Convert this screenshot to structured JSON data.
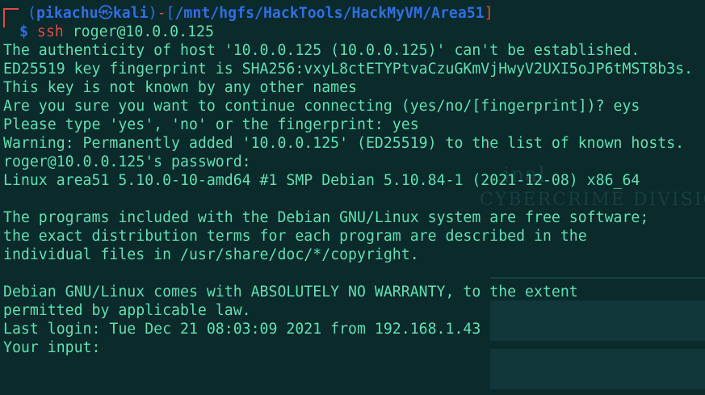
{
  "prompt": {
    "open_paren": "(",
    "user": "pikachu",
    "at_symbol": "㉿",
    "host": "kali",
    "close_paren": ")",
    "dash": "-",
    "open_bracket": "[",
    "path": "/mnt/hgfs/HackTools/HackMyVM/Area51",
    "close_bracket": "]",
    "dollar": "$",
    "command": "ssh",
    "args": "roger@10.0.0.125"
  },
  "output_lines": [
    "The authenticity of host '10.0.0.125 (10.0.0.125)' can't be established.",
    "ED25519 key fingerprint is SHA256:vxyL8ctETYPtvaCzuGKmVjHwyV2UXI5oJP6tMST8b3s.",
    "This key is not known by any other names",
    "Are you sure you want to continue connecting (yes/no/[fingerprint])? eys",
    "Please type 'yes', 'no' or the fingerprint: yes",
    "Warning: Permanently added '10.0.0.125' (ED25519) to the list of known hosts.",
    "roger@10.0.0.125's password:",
    "Linux area51 5.10.0-10-amd64 #1 SMP Debian 5.10.84-1 (2021-12-08) x86_64",
    "",
    "The programs included with the Debian GNU/Linux system are free software;",
    "the exact distribution terms for each program are described in the",
    "individual files in /usr/share/doc/*/copyright.",
    "",
    "Debian GNU/Linux comes with ABSOLUTELY NO WARRANTY, to the extent",
    "permitted by applicable law.",
    "Last login: Tue Dec 21 08:03:09 2021 from 192.168.1.43",
    "Your input:"
  ],
  "colors": {
    "background": "#0b2a2c",
    "output_text": "#5ee0b0",
    "prompt_blue": "#2f6fe0",
    "prompt_red": "#e04a4a"
  }
}
